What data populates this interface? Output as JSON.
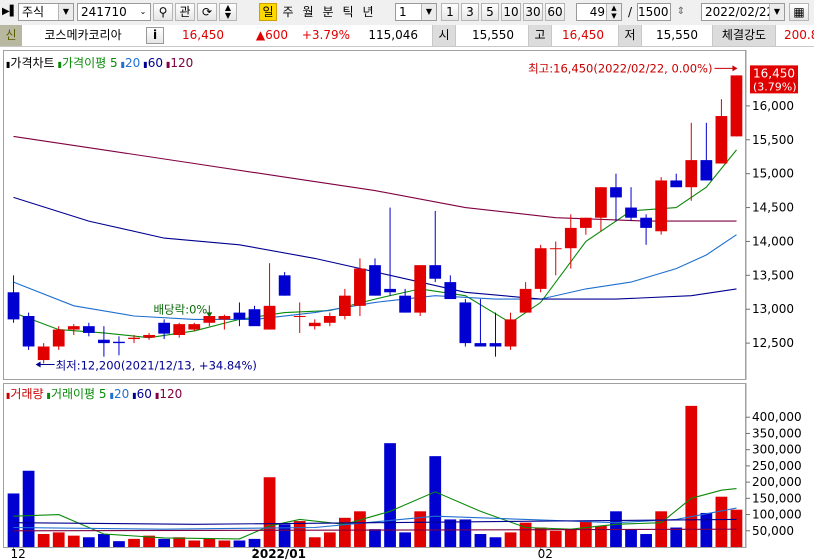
{
  "toolbar": {
    "market": "주식",
    "code": "241710",
    "btn_kwan": "관",
    "periods": [
      {
        "label": "일",
        "active": true
      },
      {
        "label": "주",
        "active": false
      },
      {
        "label": "월",
        "active": false
      },
      {
        "label": "분",
        "active": false
      },
      {
        "label": "틱",
        "active": false
      },
      {
        "label": "년",
        "active": false
      }
    ],
    "interval": "1",
    "minutes": [
      "1",
      "3",
      "5",
      "10",
      "30",
      "60"
    ],
    "view_count": "49",
    "separator": "/",
    "total_count": "1500",
    "date": "2022/02/22"
  },
  "info": {
    "badge": "신",
    "name": "코스메카코리아",
    "info_btn": "i",
    "price": "16,450",
    "change": "▲600",
    "change_pct": "+3.79%",
    "volume": "115,046",
    "open_label": "시",
    "open": "15,550",
    "high_label": "고",
    "high": "16,450",
    "low_label": "저",
    "low": "15,550",
    "strength_label": "체결강도",
    "strength": "200.8"
  },
  "price_panel": {
    "legend": [
      {
        "text": "가격차트",
        "color": "#000000"
      },
      {
        "text": "가격이평 5",
        "color": "#0a8a0a"
      },
      {
        "text": "20",
        "color": "#1f6fd0"
      },
      {
        "text": "60",
        "color": "#000090"
      },
      {
        "text": "120",
        "color": "#800040"
      }
    ],
    "high_annotation": "최고:16,450(2022/02/22, 0.00%)",
    "low_annotation": "최저:12,200(2021/12/13, +34.84%)",
    "dividend_annotation": "배당락:0%",
    "last_price": "16,450",
    "last_pct": "(3.79%)"
  },
  "volume_panel": {
    "legend": [
      {
        "text": "거래량",
        "color": "#c80000"
      },
      {
        "text": "거래이평 5",
        "color": "#0a8a0a"
      },
      {
        "text": "20",
        "color": "#1f6fd0"
      },
      {
        "text": "60",
        "color": "#000090"
      },
      {
        "text": "120",
        "color": "#800040"
      }
    ]
  },
  "chart_data": {
    "type": "candlestick",
    "up_color": "#e00000",
    "down_color": "#0000d0",
    "price_axis": {
      "min": 12000,
      "max": 16500,
      "ticks": [
        12500,
        13000,
        13500,
        14000,
        14500,
        15000,
        15500,
        16000
      ]
    },
    "price_tick_labels": [
      "12,500",
      "13,000",
      "13,500",
      "14,000",
      "14,500",
      "15,000",
      "15,500",
      "16,000"
    ],
    "volume_axis": {
      "min": 0,
      "max": 450000,
      "ticks": [
        50000,
        100000,
        150000,
        200000,
        250000,
        300000,
        350000,
        400000
      ]
    },
    "volume_tick_labels": [
      "50,000",
      "100,000",
      "150,000",
      "200,000",
      "250,000",
      "300,000",
      "350,000",
      "400,000"
    ],
    "x_labels": [
      {
        "index": 0,
        "text": "12"
      },
      {
        "index": 16,
        "text": "2022/01"
      },
      {
        "index": 35,
        "text": "02"
      }
    ],
    "candles": [
      {
        "o": 13250,
        "h": 13500,
        "l": 12800,
        "c": 12850,
        "v": 165000
      },
      {
        "o": 12900,
        "h": 12950,
        "l": 12400,
        "c": 12450,
        "v": 235000
      },
      {
        "o": 12250,
        "h": 12500,
        "l": 12200,
        "c": 12450,
        "v": 40000
      },
      {
        "o": 12450,
        "h": 12750,
        "l": 12400,
        "c": 12700,
        "v": 45000
      },
      {
        "o": 12700,
        "h": 12780,
        "l": 12620,
        "c": 12750,
        "v": 35000
      },
      {
        "o": 12750,
        "h": 12800,
        "l": 12600,
        "c": 12650,
        "v": 30000
      },
      {
        "o": 12550,
        "h": 12750,
        "l": 12300,
        "c": 12500,
        "v": 40000
      },
      {
        "o": 12520,
        "h": 12600,
        "l": 12320,
        "c": 12500,
        "v": 18000
      },
      {
        "o": 12560,
        "h": 12620,
        "l": 12500,
        "c": 12580,
        "v": 25000
      },
      {
        "o": 12580,
        "h": 12650,
        "l": 12550,
        "c": 12620,
        "v": 35000
      },
      {
        "o": 12800,
        "h": 12850,
        "l": 12560,
        "c": 12640,
        "v": 25000
      },
      {
        "o": 12620,
        "h": 12800,
        "l": 12580,
        "c": 12780,
        "v": 30000
      },
      {
        "o": 12700,
        "h": 12800,
        "l": 12680,
        "c": 12780,
        "v": 20000
      },
      {
        "o": 12800,
        "h": 12950,
        "l": 12750,
        "c": 12900,
        "v": 25000
      },
      {
        "o": 12850,
        "h": 12920,
        "l": 12700,
        "c": 12900,
        "v": 20000
      },
      {
        "o": 12950,
        "h": 13100,
        "l": 12750,
        "c": 12850,
        "v": 20000
      },
      {
        "o": 13000,
        "h": 13050,
        "l": 12850,
        "c": 12750,
        "v": 25000
      },
      {
        "o": 12700,
        "h": 13680,
        "l": 12700,
        "c": 13050,
        "v": 215000
      },
      {
        "o": 13500,
        "h": 13550,
        "l": 13200,
        "c": 13200,
        "v": 70000
      },
      {
        "o": 12900,
        "h": 13100,
        "l": 12650,
        "c": 12900,
        "v": 80000
      },
      {
        "o": 12750,
        "h": 12850,
        "l": 12700,
        "c": 12800,
        "v": 30000
      },
      {
        "o": 12800,
        "h": 12950,
        "l": 12750,
        "c": 12900,
        "v": 45000
      },
      {
        "o": 12900,
        "h": 13300,
        "l": 12850,
        "c": 13200,
        "v": 90000
      },
      {
        "o": 13050,
        "h": 13750,
        "l": 12900,
        "c": 13600,
        "v": 110000
      },
      {
        "o": 13650,
        "h": 13750,
        "l": 13200,
        "c": 13200,
        "v": 55000
      },
      {
        "o": 13300,
        "h": 14500,
        "l": 13200,
        "c": 13250,
        "v": 320000
      },
      {
        "o": 13200,
        "h": 13300,
        "l": 12950,
        "c": 12950,
        "v": 45000
      },
      {
        "o": 12950,
        "h": 13650,
        "l": 12900,
        "c": 13650,
        "v": 110000
      },
      {
        "o": 13650,
        "h": 14450,
        "l": 13400,
        "c": 13450,
        "v": 280000
      },
      {
        "o": 13400,
        "h": 13500,
        "l": 13150,
        "c": 13150,
        "v": 85000
      },
      {
        "o": 13100,
        "h": 13150,
        "l": 12450,
        "c": 12500,
        "v": 85000
      },
      {
        "o": 12500,
        "h": 13150,
        "l": 12450,
        "c": 12450,
        "v": 40000
      },
      {
        "o": 12500,
        "h": 12950,
        "l": 12300,
        "c": 12450,
        "v": 30000
      },
      {
        "o": 12450,
        "h": 12950,
        "l": 12400,
        "c": 12850,
        "v": 45000
      },
      {
        "o": 12950,
        "h": 13400,
        "l": 12950,
        "c": 13300,
        "v": 75000
      },
      {
        "o": 13300,
        "h": 13950,
        "l": 13250,
        "c": 13900,
        "v": 60000
      },
      {
        "o": 13900,
        "h": 14000,
        "l": 13500,
        "c": 13900,
        "v": 50000
      },
      {
        "o": 13900,
        "h": 14400,
        "l": 13600,
        "c": 14200,
        "v": 55000
      },
      {
        "o": 14200,
        "h": 14350,
        "l": 14100,
        "c": 14350,
        "v": 80000
      },
      {
        "o": 14350,
        "h": 14800,
        "l": 14150,
        "c": 14800,
        "v": 65000
      },
      {
        "o": 14800,
        "h": 15000,
        "l": 14300,
        "c": 14650,
        "v": 110000
      },
      {
        "o": 14500,
        "h": 14800,
        "l": 14300,
        "c": 14350,
        "v": 55000
      },
      {
        "o": 14350,
        "h": 14400,
        "l": 13950,
        "c": 14200,
        "v": 40000
      },
      {
        "o": 14150,
        "h": 14950,
        "l": 14100,
        "c": 14900,
        "v": 110000
      },
      {
        "o": 14900,
        "h": 15000,
        "l": 14800,
        "c": 14800,
        "v": 60000
      },
      {
        "o": 14800,
        "h": 15750,
        "l": 14600,
        "c": 15200,
        "v": 435000
      },
      {
        "o": 15200,
        "h": 15750,
        "l": 14900,
        "c": 14900,
        "v": 105000
      },
      {
        "o": 15150,
        "h": 16100,
        "l": 15150,
        "c": 15850,
        "v": 155000
      },
      {
        "o": 15550,
        "h": 16450,
        "l": 15550,
        "c": 16450,
        "v": 115046
      }
    ],
    "price_ma": [
      {
        "name": "5",
        "color": "#0a8a0a",
        "values": [
          [
            0,
            12950
          ],
          [
            3,
            12700
          ],
          [
            6,
            12650
          ],
          [
            9,
            12580
          ],
          [
            12,
            12680
          ],
          [
            15,
            12850
          ],
          [
            18,
            12950
          ],
          [
            21,
            12980
          ],
          [
            24,
            13150
          ],
          [
            27,
            13300
          ],
          [
            30,
            13200
          ],
          [
            33,
            12800
          ],
          [
            35,
            13100
          ],
          [
            38,
            14000
          ],
          [
            41,
            14450
          ],
          [
            44,
            14500
          ],
          [
            46,
            14800
          ],
          [
            48,
            15350
          ]
        ]
      },
      {
        "name": "20",
        "color": "#1f6fd0",
        "values": [
          [
            0,
            13400
          ],
          [
            4,
            13050
          ],
          [
            8,
            12900
          ],
          [
            12,
            12850
          ],
          [
            16,
            12850
          ],
          [
            20,
            12950
          ],
          [
            24,
            13100
          ],
          [
            28,
            13200
          ],
          [
            32,
            13150
          ],
          [
            35,
            13150
          ],
          [
            38,
            13300
          ],
          [
            41,
            13400
          ],
          [
            44,
            13600
          ],
          [
            46,
            13800
          ],
          [
            48,
            14100
          ]
        ]
      },
      {
        "name": "60",
        "color": "#000090",
        "values": [
          [
            0,
            14650
          ],
          [
            5,
            14300
          ],
          [
            10,
            14050
          ],
          [
            15,
            13950
          ],
          [
            20,
            13750
          ],
          [
            25,
            13500
          ],
          [
            30,
            13250
          ],
          [
            35,
            13150
          ],
          [
            40,
            13150
          ],
          [
            45,
            13200
          ],
          [
            48,
            13300
          ]
        ]
      },
      {
        "name": "120",
        "color": "#800040",
        "values": [
          [
            0,
            15550
          ],
          [
            6,
            15350
          ],
          [
            12,
            15150
          ],
          [
            18,
            14950
          ],
          [
            24,
            14750
          ],
          [
            30,
            14500
          ],
          [
            36,
            14350
          ],
          [
            42,
            14300
          ],
          [
            48,
            14300
          ]
        ]
      }
    ],
    "volume_ma": [
      {
        "name": "5",
        "color": "#0a8a0a",
        "values": [
          [
            0,
            95000
          ],
          [
            3,
            100000
          ],
          [
            6,
            40000
          ],
          [
            10,
            28000
          ],
          [
            15,
            25000
          ],
          [
            17,
            65000
          ],
          [
            19,
            85000
          ],
          [
            22,
            70000
          ],
          [
            25,
            110000
          ],
          [
            28,
            170000
          ],
          [
            31,
            110000
          ],
          [
            34,
            60000
          ],
          [
            37,
            55000
          ],
          [
            40,
            70000
          ],
          [
            43,
            75000
          ],
          [
            45,
            150000
          ],
          [
            47,
            175000
          ],
          [
            48,
            180000
          ]
        ]
      },
      {
        "name": "20",
        "color": "#1f6fd0",
        "values": [
          [
            0,
            60000
          ],
          [
            10,
            55000
          ],
          [
            20,
            60000
          ],
          [
            28,
            95000
          ],
          [
            34,
            85000
          ],
          [
            40,
            75000
          ],
          [
            44,
            85000
          ],
          [
            48,
            120000
          ]
        ]
      },
      {
        "name": "60",
        "color": "#000090",
        "values": [
          [
            0,
            75000
          ],
          [
            12,
            70000
          ],
          [
            24,
            75000
          ],
          [
            36,
            80000
          ],
          [
            48,
            85000
          ]
        ]
      },
      {
        "name": "120",
        "color": "#800040",
        "values": [
          [
            0,
            50000
          ],
          [
            24,
            52000
          ],
          [
            48,
            55000
          ]
        ]
      }
    ]
  }
}
